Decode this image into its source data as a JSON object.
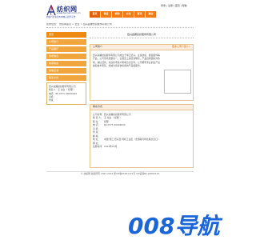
{
  "header": {
    "logo_title": "纺织网",
    "logo_domain": "www.texnet.com.cn",
    "logo_tagline": "纺织行业专业B2B电子商务平台",
    "top_links": "登录 | 注册 | 首页 | 帮助",
    "nav": [
      "首页",
      "供应",
      "求购",
      "公司",
      "资讯",
      "展会"
    ]
  },
  "breadcrumb": "您的位置： 纺织网首页 > 企业 > 绍兴昌耀纺织服饰有限公司",
  "sidebar": {
    "items": [
      "首页",
      "公司简介",
      "产品展厅",
      "供求信息",
      "新闻动态",
      "资信证书",
      "联系方式"
    ],
    "contact": {
      "company": "绍兴昌耀纺织服饰有限公司",
      "person_label": "联系人：",
      "person": "王 先生（ 经理 ）",
      "phone_label": "电话：",
      "phone": "86 0575 40006020",
      "mobile_label": "手机：",
      "mobile": "",
      "fax_label": "传真：",
      "fax": ""
    }
  },
  "main": {
    "company_title": "绍兴昌耀纺织服饰有限公司",
    "intro_panel": {
      "title": "公司简介",
      "more": "更多公司介绍>>",
      "body": "绍兴昌耀纺织服饰有限公司成立于浙江绍兴，主营纺织、服装服饰等产品，公司坚持质量第一、信誉至上的经营理念，产品远销国内外各地，诚信经营，欢迎新老客户来电洽谈合作。公司拥有专业的生产设备和技术团队，竭诚为您提供优质的产品和服务。"
    },
    "detail_panel": {
      "title": "联系方式",
      "rows": [
        {
          "k": "公司名称：",
          "v": "绍兴昌耀纺织服饰有限公司"
        },
        {
          "k": "联 系 人：",
          "v": "王 先生（ 经理 ）"
        },
        {
          "k": "职    位：",
          "v": "经理"
        },
        {
          "k": "电    话：",
          "v": "86 0575 40006020"
        },
        {
          "k": "手    机：",
          "v": ""
        },
        {
          "k": "传    真：",
          "v": ""
        },
        {
          "k": "邮    编：",
          "v": ""
        },
        {
          "k": "地    址：",
          "v": "中国 浙江 绍兴县 柯桥工业区（金通路与柯北路交叉口）"
        },
        {
          "k": "网    址：",
          "v": ""
        },
        {
          "k": "注册时间：",
          "v": "2012年03月"
        }
      ]
    }
  },
  "footer": "© 纺织网 版权所有 1997-2019  浙ICP备05001321号  ICP证浙B2-20080110",
  "watermark": "008导航",
  "colors": {
    "accent": "#f27a10",
    "sidebar": "#f0a63c",
    "logo": "#2b3b8f",
    "watermark": "#1a66d9"
  }
}
